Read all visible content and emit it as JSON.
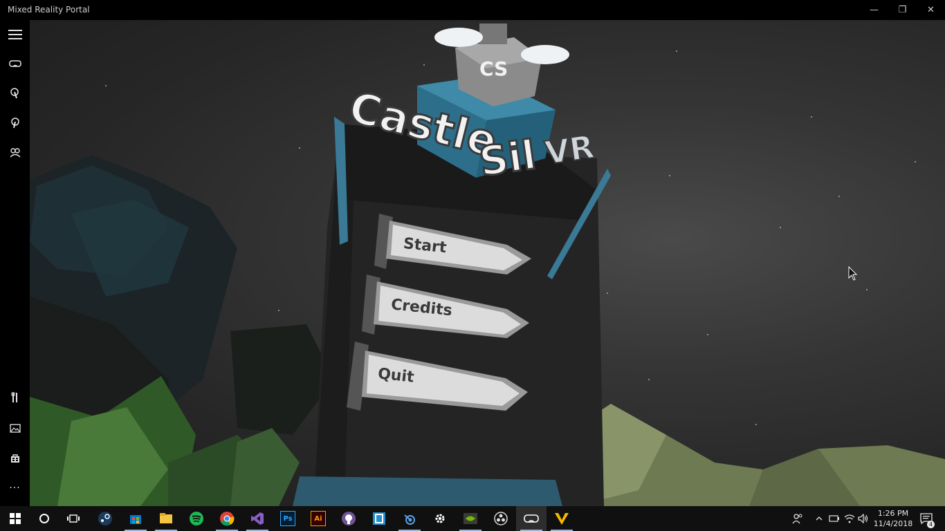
{
  "window": {
    "title": "Mixed Reality Portal",
    "controls": {
      "minimize": "—",
      "restore": "❐",
      "close": "✕"
    }
  },
  "sidebar": {
    "top_items": [
      {
        "name": "menu-icon"
      },
      {
        "name": "headset-icon"
      },
      {
        "name": "controller-left-icon"
      },
      {
        "name": "controller-right-icon"
      },
      {
        "name": "people-icon"
      }
    ],
    "bottom_items": [
      {
        "name": "tools-icon"
      },
      {
        "name": "photos-icon"
      },
      {
        "name": "store-icon"
      },
      {
        "name": "more-icon",
        "label": "···"
      }
    ]
  },
  "game": {
    "logo": {
      "part1": "Castle",
      "part2": "Sil",
      "part3": "VR",
      "emblem": "CS"
    },
    "menu": {
      "start": "Start",
      "credits": "Credits",
      "quit": "Quit"
    }
  },
  "taskbar": {
    "apps": [
      {
        "name": "windows-start-icon"
      },
      {
        "name": "cortana-icon"
      },
      {
        "name": "task-view-icon"
      },
      {
        "name": "steam-icon"
      },
      {
        "name": "microsoft-store-icon"
      },
      {
        "name": "file-explorer-icon"
      },
      {
        "name": "spotify-icon"
      },
      {
        "name": "chrome-icon"
      },
      {
        "name": "visual-studio-icon"
      },
      {
        "name": "photoshop-icon",
        "label": "Ps"
      },
      {
        "name": "illustrator-icon",
        "label": "Ai"
      },
      {
        "name": "github-icon"
      },
      {
        "name": "app-bracket-icon"
      },
      {
        "name": "blender-icon"
      },
      {
        "name": "settings-icon"
      },
      {
        "name": "nvidia-icon"
      },
      {
        "name": "obs-icon"
      },
      {
        "name": "mixed-reality-portal-icon"
      },
      {
        "name": "vectorworks-icon"
      }
    ],
    "tray": {
      "time": "1:26 PM",
      "date": "11/4/2018",
      "notifications": "4"
    }
  },
  "colors": {
    "accent": "#9fb4d6",
    "sky": "#2b2b2b",
    "cube": "#2d6f8a",
    "grass": "#6e7a52",
    "tree": "#2f5a27"
  }
}
